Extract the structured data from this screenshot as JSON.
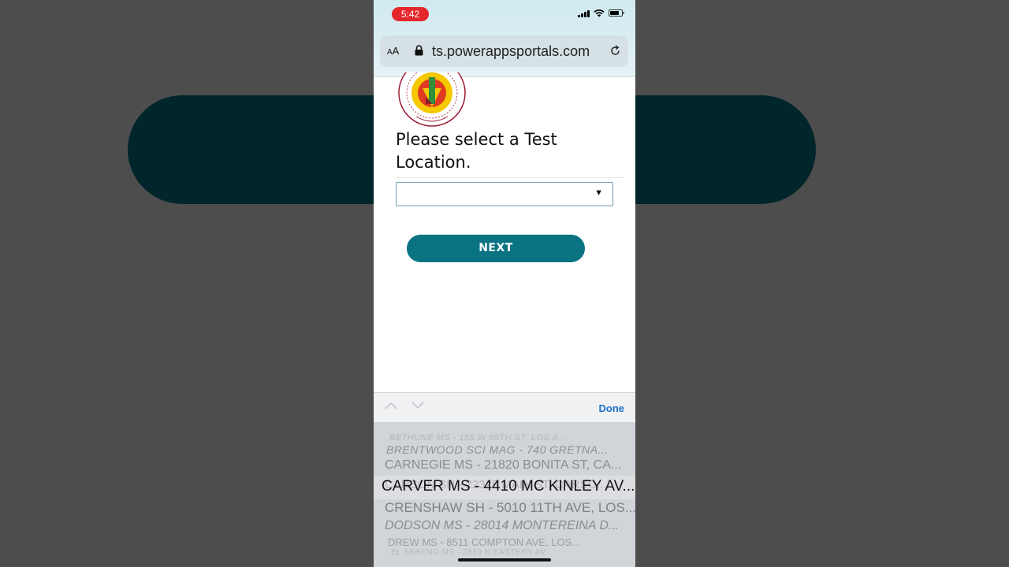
{
  "status_bar": {
    "time": "5:42"
  },
  "browser": {
    "text_size_button": "AA",
    "url": "ts.powerappsportals.com"
  },
  "form": {
    "prompt": "Please select a Test Location.",
    "select_value": "",
    "dropdown_arrow": "▼",
    "next_label": "NEXT"
  },
  "keyboard_toolbar": {
    "done_label": "Done"
  },
  "picker": {
    "options": [
      "BETHUNE MS - 155 W 69TH ST, LOS A...",
      "BRENTWOOD SCI MAG - 740 GRETNA...",
      "CARNEGIE MS - 21820 BONITA ST, CA...",
      "CARSON SH - 22328 MAIN ST, CARSO...",
      "CARVER MS - 4410 MC KINLEY AV...",
      "CRENSHAW SH - 5010 11TH AVE, LOS...",
      "DODSON MS - 28014 MONTEREINA D...",
      "DREW MS - 8511 COMPTON AVE, LOS...",
      "EL SERENO MS - 2839 N EASTERN AV..."
    ],
    "selected_index": 4
  },
  "colors": {
    "primary_button": "#0a7382",
    "time_pill": "#e5262b",
    "done_link": "#1f6fc9"
  }
}
